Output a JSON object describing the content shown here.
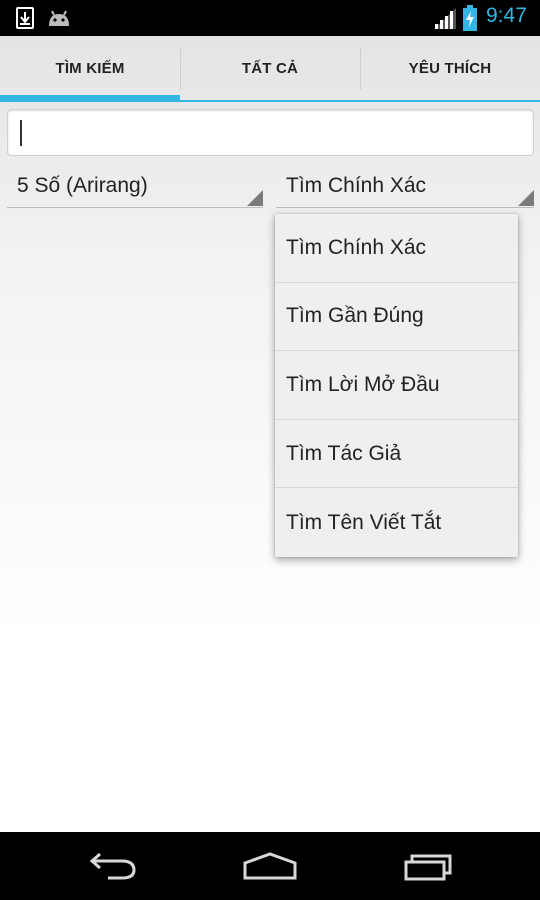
{
  "status_bar": {
    "time": "9:47",
    "icons": [
      "download-icon",
      "android-robot-icon",
      "signal-icon",
      "battery-charging-icon"
    ]
  },
  "tabs": [
    {
      "label": "TÌM KIẾM",
      "selected": true
    },
    {
      "label": "TẤT CẢ",
      "selected": false
    },
    {
      "label": "YÊU THÍCH",
      "selected": false
    }
  ],
  "search": {
    "value": "",
    "placeholder": ""
  },
  "filters": {
    "left": {
      "selected": "5 Số (Arirang)"
    },
    "right": {
      "selected": "Tìm Chính Xác"
    }
  },
  "dropdown": {
    "items": [
      "Tìm Chính Xác",
      "Tìm Gần Đúng",
      "Tìm Lời Mở Đầu",
      "Tìm Tác Giả",
      "Tìm Tên Viết Tắt"
    ]
  },
  "nav_bar": {
    "icons": [
      "back-icon",
      "home-icon",
      "recent-apps-icon"
    ]
  },
  "colors": {
    "accent": "#33b5e5",
    "status_bar": "#000000",
    "nav_bar": "#000000"
  }
}
